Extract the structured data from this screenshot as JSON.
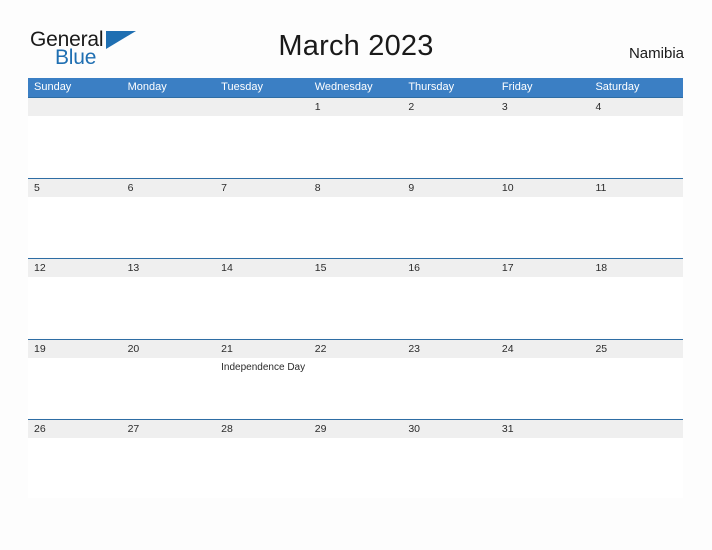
{
  "brand": {
    "name_part1": "General",
    "name_part2": "Blue",
    "triangle_icon": "triangle-icon",
    "accent_color": "#1f6fb2"
  },
  "header": {
    "title": "March 2023",
    "country": "Namibia"
  },
  "calendar": {
    "month": "March",
    "year": "2023",
    "header_color": "#3b7fc4",
    "band_color": "#efefef",
    "divider_color": "#2e6da4",
    "weekdays": [
      "Sunday",
      "Monday",
      "Tuesday",
      "Wednesday",
      "Thursday",
      "Friday",
      "Saturday"
    ],
    "weeks": [
      {
        "days": [
          {
            "num": "",
            "event": ""
          },
          {
            "num": "",
            "event": ""
          },
          {
            "num": "",
            "event": ""
          },
          {
            "num": "1",
            "event": ""
          },
          {
            "num": "2",
            "event": ""
          },
          {
            "num": "3",
            "event": ""
          },
          {
            "num": "4",
            "event": ""
          }
        ]
      },
      {
        "days": [
          {
            "num": "5",
            "event": ""
          },
          {
            "num": "6",
            "event": ""
          },
          {
            "num": "7",
            "event": ""
          },
          {
            "num": "8",
            "event": ""
          },
          {
            "num": "9",
            "event": ""
          },
          {
            "num": "10",
            "event": ""
          },
          {
            "num": "11",
            "event": ""
          }
        ]
      },
      {
        "days": [
          {
            "num": "12",
            "event": ""
          },
          {
            "num": "13",
            "event": ""
          },
          {
            "num": "14",
            "event": ""
          },
          {
            "num": "15",
            "event": ""
          },
          {
            "num": "16",
            "event": ""
          },
          {
            "num": "17",
            "event": ""
          },
          {
            "num": "18",
            "event": ""
          }
        ]
      },
      {
        "days": [
          {
            "num": "19",
            "event": ""
          },
          {
            "num": "20",
            "event": ""
          },
          {
            "num": "21",
            "event": "Independence Day"
          },
          {
            "num": "22",
            "event": ""
          },
          {
            "num": "23",
            "event": ""
          },
          {
            "num": "24",
            "event": ""
          },
          {
            "num": "25",
            "event": ""
          }
        ]
      },
      {
        "days": [
          {
            "num": "26",
            "event": ""
          },
          {
            "num": "27",
            "event": ""
          },
          {
            "num": "28",
            "event": ""
          },
          {
            "num": "29",
            "event": ""
          },
          {
            "num": "30",
            "event": ""
          },
          {
            "num": "31",
            "event": ""
          },
          {
            "num": "",
            "event": ""
          }
        ]
      }
    ]
  }
}
